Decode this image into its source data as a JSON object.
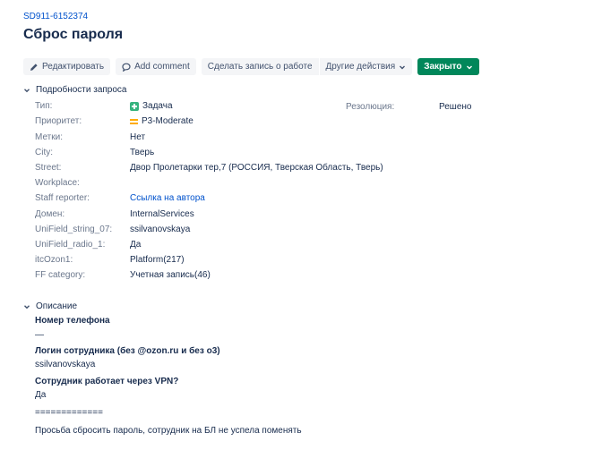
{
  "issue": {
    "key": "SD911-6152374",
    "title": "Сброс пароля"
  },
  "toolbar": {
    "edit_label": "Редактировать",
    "comment_label": "Add comment",
    "work_log_label": "Сделать запись о работе",
    "more_actions_label": "Другие действия",
    "status_label": "Закрыто"
  },
  "details": {
    "heading": "Подробности запроса",
    "resolution_label": "Резолюция:",
    "resolution_value": "Решено",
    "fields": [
      {
        "label": "Тип:",
        "value": "Задача"
      },
      {
        "label": "Приоритет:",
        "value": "P3-Moderate"
      },
      {
        "label": "Метки:",
        "value": "Нет"
      },
      {
        "label": "City:",
        "value": "Тверь"
      },
      {
        "label": "Street:",
        "value": "Двор Пролетарки тер,7 (РОССИЯ, Тверская Область, Тверь)"
      },
      {
        "label": "Workplace:",
        "value": ""
      },
      {
        "label": "Staff reporter:",
        "value": "Ссылка на автора"
      },
      {
        "label": "Домен:",
        "value": "InternalServices"
      },
      {
        "label": "UniField_string_07:",
        "value": "ssilvanovskaya"
      },
      {
        "label": "UniField_radio_1:",
        "value": "Да"
      },
      {
        "label": "itcOzon1:",
        "value": "Platform(217)"
      },
      {
        "label": "FF category:",
        "value": "Учетная запись(46)"
      }
    ]
  },
  "description": {
    "heading": "Описание",
    "lines": [
      {
        "text": "Номер телефона"
      },
      {
        "text": "—"
      },
      {
        "text": "Логин сотрудника (без @ozon.ru и без o3)"
      },
      {
        "text": "ssilvanovskaya"
      },
      {
        "text": "Сотрудник работает через VPN?"
      },
      {
        "text": "Да"
      },
      {
        "text": "============="
      },
      {
        "text": "Просьба сбросить пароль, сотрудник на БЛ не успела поменять"
      }
    ]
  },
  "icons": {
    "edit": "pencil-icon",
    "comment": "comment-icon",
    "type": "task-plus-icon",
    "priority": "priority-medium-icon",
    "chevron": "chevron-down-icon"
  },
  "colors": {
    "link": "#0052cc",
    "status": "#00875a",
    "label": "#6b778c",
    "text": "#172b4d",
    "button_bg": "#f4f5f7"
  }
}
